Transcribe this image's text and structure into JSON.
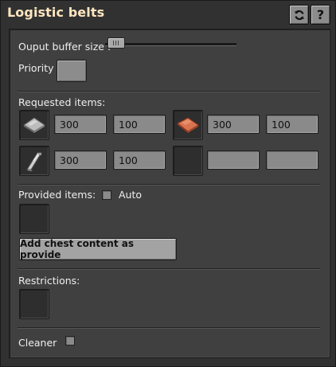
{
  "window": {
    "title": "Logistic belts"
  },
  "header_buttons": {
    "refresh_icon": "refresh-icon",
    "help_label": "?"
  },
  "output_buffer": {
    "label": "Ouput buffer size :",
    "value": 0
  },
  "priority": {
    "label": "Priority"
  },
  "requested": {
    "label": "Requested items:",
    "rows": [
      [
        {
          "icon": "iron-plate-icon",
          "amount": "300",
          "min": "100"
        },
        {
          "icon": "copper-plate-icon",
          "amount": "300",
          "min": "100"
        }
      ],
      [
        {
          "icon": "steel-plate-icon",
          "amount": "300",
          "min": "100"
        },
        {
          "icon": "",
          "amount": "",
          "min": ""
        }
      ]
    ]
  },
  "provided": {
    "label": "Provided items:",
    "auto_label": "Auto",
    "auto_checked": false
  },
  "add_button": {
    "label": "Add chest content as provide"
  },
  "restrictions": {
    "label": "Restrictions:"
  },
  "cleaner": {
    "label": "Cleaner",
    "checked": false
  },
  "colors": {
    "title": "#ffe6c0",
    "panel": "#404040",
    "field": "#8a8a8a"
  }
}
